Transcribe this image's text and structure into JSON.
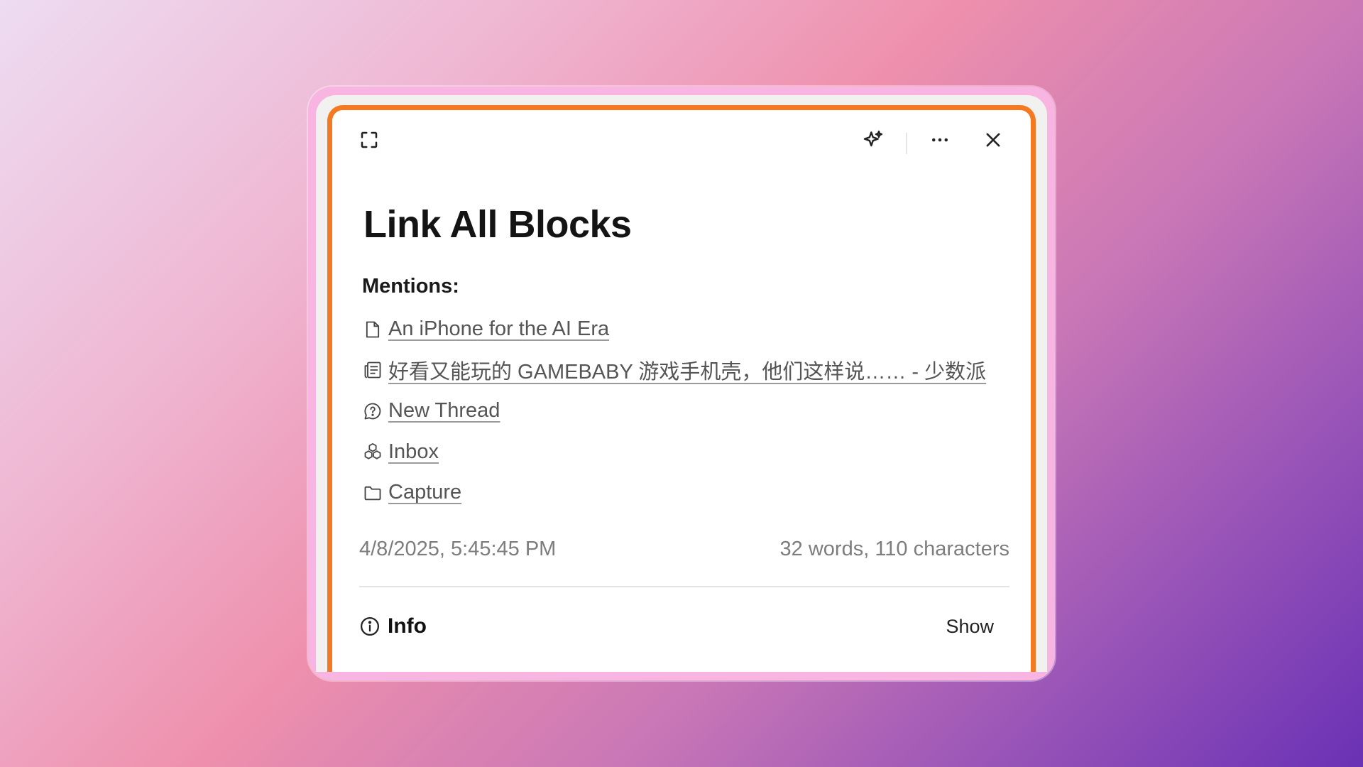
{
  "toolbar": {
    "expand_icon": "expand-icon",
    "ai_icon": "sparkles-icon",
    "more_icon": "more-horizontal-icon",
    "close_icon": "close-icon"
  },
  "page": {
    "title": "Link All Blocks",
    "mentions_heading": "Mentions:",
    "mentions": [
      {
        "icon": "document-icon",
        "label": "An iPhone for the AI Era"
      },
      {
        "icon": "article-icon",
        "label": "好看又能玩的 GAMEBABY 游戏手机壳，他们这样说…… - 少数派"
      },
      {
        "icon": "chat-bubble-question-icon",
        "label": "New Thread"
      },
      {
        "icon": "cubes-icon",
        "label": "Inbox"
      },
      {
        "icon": "folder-icon",
        "label": "Capture"
      }
    ],
    "timestamp": "4/8/2025, 5:45:45 PM",
    "word_count": "32 words, 110 characters"
  },
  "info": {
    "label": "Info",
    "toggle_label": "Show"
  },
  "colors": {
    "accent_border": "#f47920",
    "frame_pink": "#f8b5e2",
    "text_muted": "#7d7d7d"
  }
}
